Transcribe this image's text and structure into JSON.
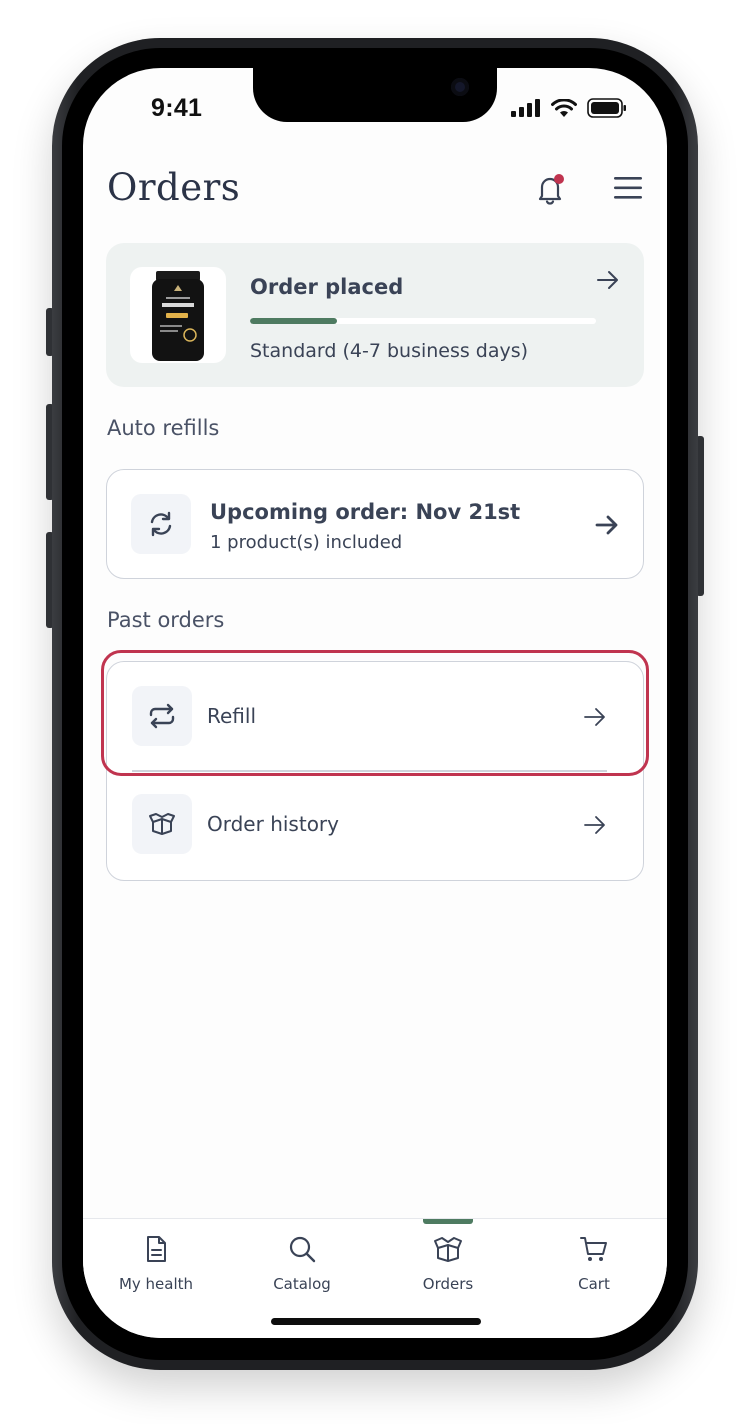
{
  "status_bar": {
    "time": "9:41"
  },
  "header": {
    "title": "Orders"
  },
  "current_order": {
    "status": "Order placed",
    "progress": 0.25,
    "shipping": "Standard (4-7 business days)"
  },
  "auto_refills": {
    "heading": "Auto refills",
    "title": "Upcoming order: Nov 21st",
    "subtitle": "1 product(s) included"
  },
  "past_orders": {
    "heading": "Past orders",
    "rows": [
      {
        "label": "Refill",
        "icon": "refresh-icon"
      },
      {
        "label": "Order history",
        "icon": "box-icon"
      }
    ]
  },
  "tabs": [
    {
      "label": "My health",
      "icon": "document-icon"
    },
    {
      "label": "Catalog",
      "icon": "search-icon"
    },
    {
      "label": "Orders",
      "icon": "box-icon",
      "active": true
    },
    {
      "label": "Cart",
      "icon": "cart-icon"
    }
  ],
  "colors": {
    "accent_green": "#4e7b61",
    "highlight": "#c0344f",
    "notification_dot": "#c0344f",
    "text": "#3a4356"
  }
}
